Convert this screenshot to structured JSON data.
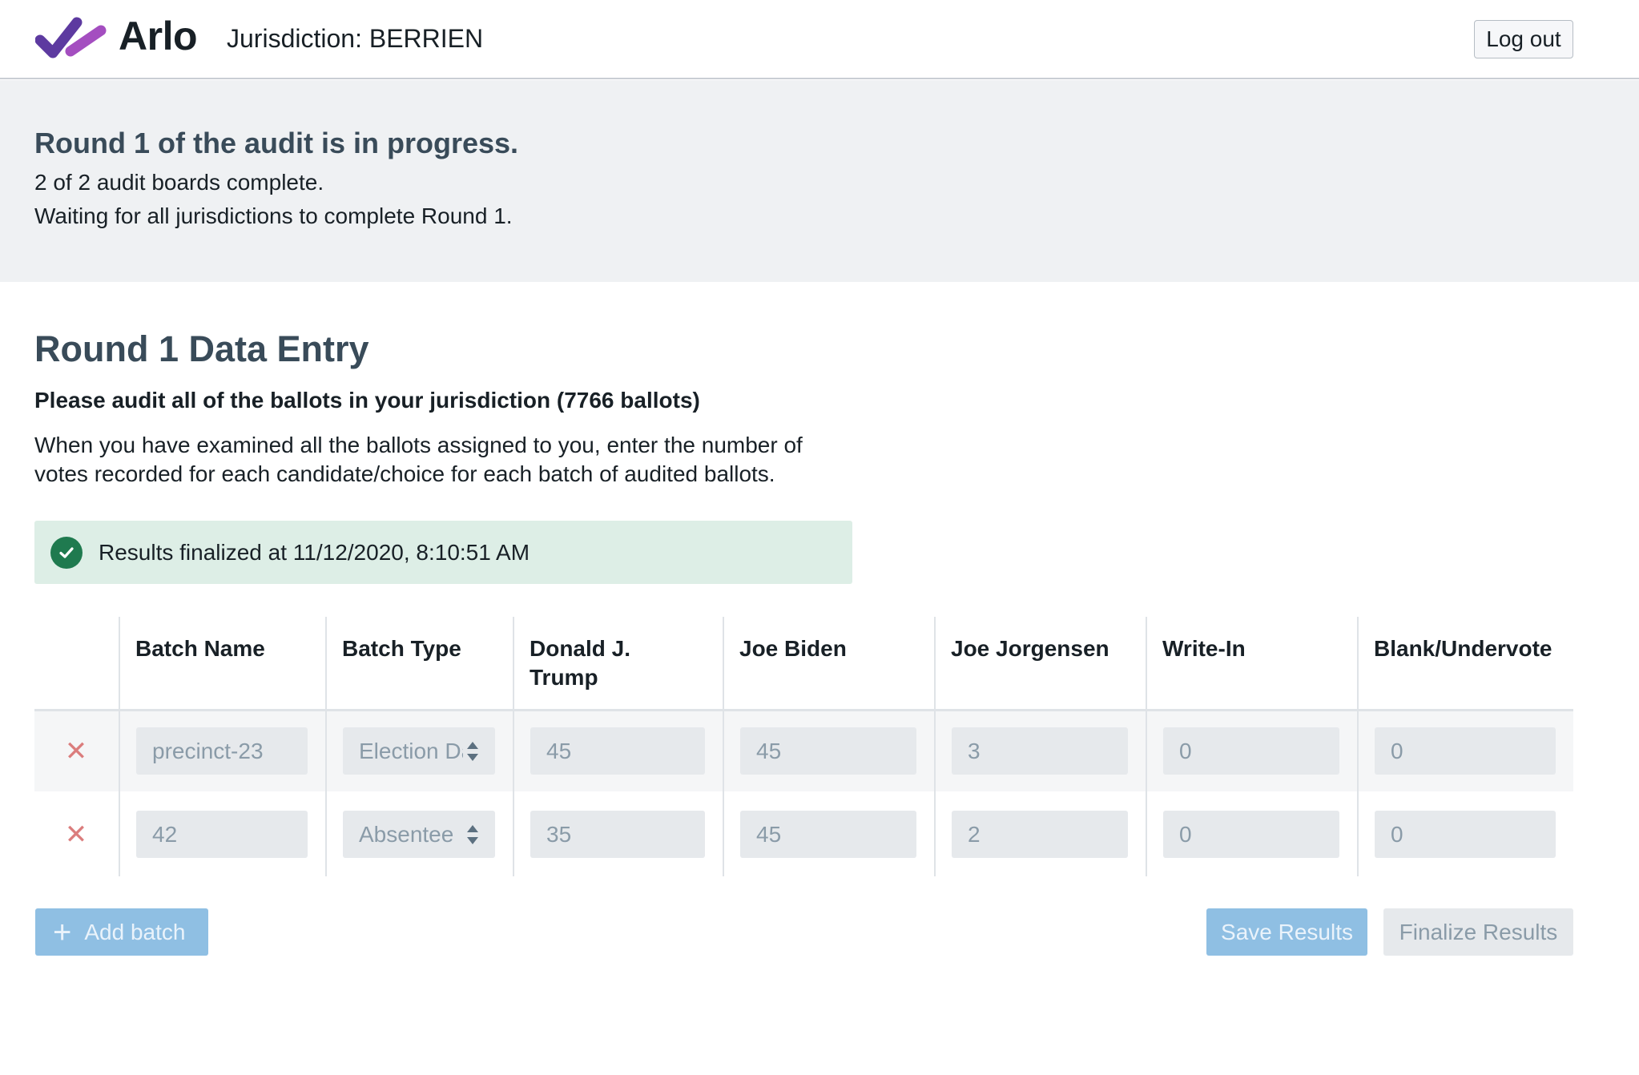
{
  "header": {
    "brand": "Arlo",
    "jurisdiction": "Jurisdiction: BERRIEN",
    "logout_label": "Log out",
    "logo_colors": [
      "#7a4fb3",
      "#a44ec0"
    ]
  },
  "status": {
    "title": "Round 1 of the audit is in progress.",
    "boards": "2 of 2 audit boards complete.",
    "waiting": "Waiting for all jurisdictions to complete Round 1."
  },
  "main": {
    "title": "Round 1 Data Entry",
    "instruction_bold": "Please audit all of the ballots in your jurisdiction (7766 ballots)",
    "instruction": "When you have examined all the ballots assigned to you, enter the number of votes recorded for each candidate/choice for each batch of audited ballots.",
    "callout": {
      "text": "Results finalized at 11/12/2020, 8:10:51 AM",
      "icon": "check-circle-icon",
      "color": "#1f7a4f"
    }
  },
  "table": {
    "headers": [
      "Batch Name",
      "Batch Type",
      "Donald J. Trump",
      "Joe Biden",
      "Joe Jorgensen",
      "Write-In",
      "Blank/Undervote"
    ],
    "rows": [
      {
        "batch_name": "precinct-23",
        "batch_type": "Election Day",
        "trump": "45",
        "biden": "45",
        "jorgensen": "3",
        "write_in": "0",
        "blank": "0"
      },
      {
        "batch_name": "42",
        "batch_type": "Absentee",
        "trump": "35",
        "biden": "45",
        "jorgensen": "2",
        "write_in": "0",
        "blank": "0"
      }
    ],
    "delete_icon": "close-icon",
    "delete_color": "#db7d7d"
  },
  "actions": {
    "add_batch": "Add batch",
    "save": "Save Results",
    "finalize": "Finalize Results"
  }
}
